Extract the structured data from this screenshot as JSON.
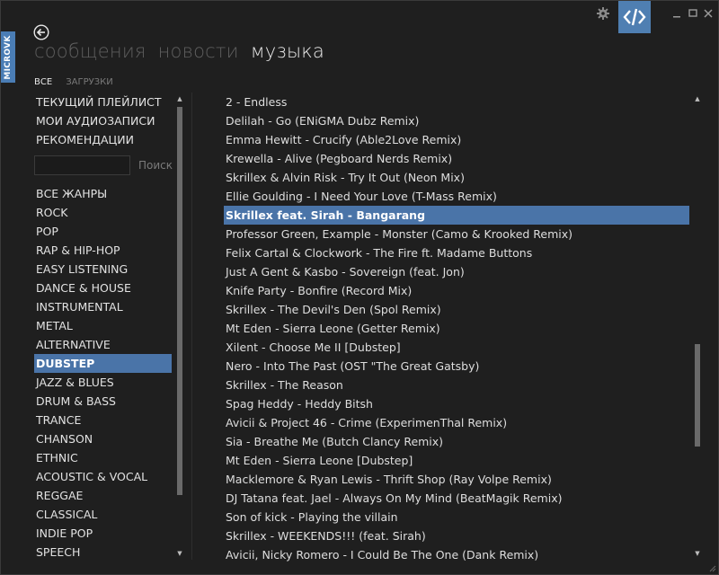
{
  "side_tab": {
    "label": "MICROVK"
  },
  "nav": {
    "tabs": [
      {
        "label": "сообщения",
        "active": false
      },
      {
        "label": "новости",
        "active": false
      },
      {
        "label": "музыка",
        "active": true
      }
    ]
  },
  "sub_tabs": [
    {
      "label": "ВСЕ",
      "active": true
    },
    {
      "label": "ЗАГРУЗКИ",
      "active": false
    }
  ],
  "sidebar": {
    "playlists": [
      "ТЕКУЩИЙ ПЛЕЙЛИСТ",
      "МОИ АУДИОЗАПИСИ",
      "РЕКОМЕНДАЦИИ"
    ],
    "search": {
      "value": "",
      "label": "Поиск"
    },
    "genres": [
      "ВСЕ ЖАНРЫ",
      "ROCK",
      "POP",
      "RAP & HIP-HOP",
      "EASY LISTENING",
      "DANCE & HOUSE",
      "INSTRUMENTAL",
      "METAL",
      "ALTERNATIVE",
      "DUBSTEP",
      "JAZZ & BLUES",
      "DRUM & BASS",
      "TRANCE",
      "CHANSON",
      "ETHNIC",
      "ACOUSTIC & VOCAL",
      "REGGAE",
      "CLASSICAL",
      "INDIE POP",
      "SPEECH"
    ],
    "selected_genre": "DUBSTEP"
  },
  "tracks": {
    "items": [
      "2 - Endless",
      "Delilah - Go (ENiGMA Dubz Remix)",
      "Emma Hewitt - Crucify (Able2Love Remix)",
      "Krewella - Alive (Pegboard Nerds Remix)",
      "Skrillex & Alvin Risk - Try It Out (Neon Mix)",
      "Ellie Goulding - I Need Your Love (T-Mass Remix)",
      "Skrillex feat. Sirah - Bangarang",
      "Professor Green, Example - Monster (Camo & Krooked Remix)",
      "Felix Cartal & Clockwork - The Fire ft. Madame Buttons",
      "Just A Gent & Kasbo - Sovereign (feat. Jon)",
      "Knife Party - Bonfire (Record Mix)",
      "Skrillex - The Devil's Den (Spol Remix)",
      "Mt Eden - Sierra Leone (Getter Remix)",
      "Xilent - Choose Me II [Dubstep]",
      "Nero - Into The Past (OST \"The Great Gatsby)",
      "Skrillex - The Reason",
      "Spag Heddy - Heddy Bitsh",
      "Avicii & Project 46  - Crime (ExperimenThal Remix)",
      "Sia - Breathe Me (Butch Clancy Remix)",
      "Mt Eden - Sierra Leone [Dubstep]",
      "Macklemore & Ryan Lewis - Thrift Shop (Ray Volpe Remix)",
      "DJ Tatana feat. Jael - Always On My Mind (BeatMagik Remix)",
      "Son of kick - Playing the villain",
      "Skrillex - WEEKENDS!!! (feat. Sirah)",
      "Avicii, Nicky Romero - I Could Be The One (Dank Remix)"
    ],
    "selected_index": 6
  },
  "colors": {
    "background": "#1f1f1f",
    "accent": "#4a74a8",
    "inactive_text": "#5e5e5e"
  },
  "icons": {
    "settings": "gear-icon",
    "logo": "code-brackets-icon",
    "back": "back-arrow-icon"
  }
}
